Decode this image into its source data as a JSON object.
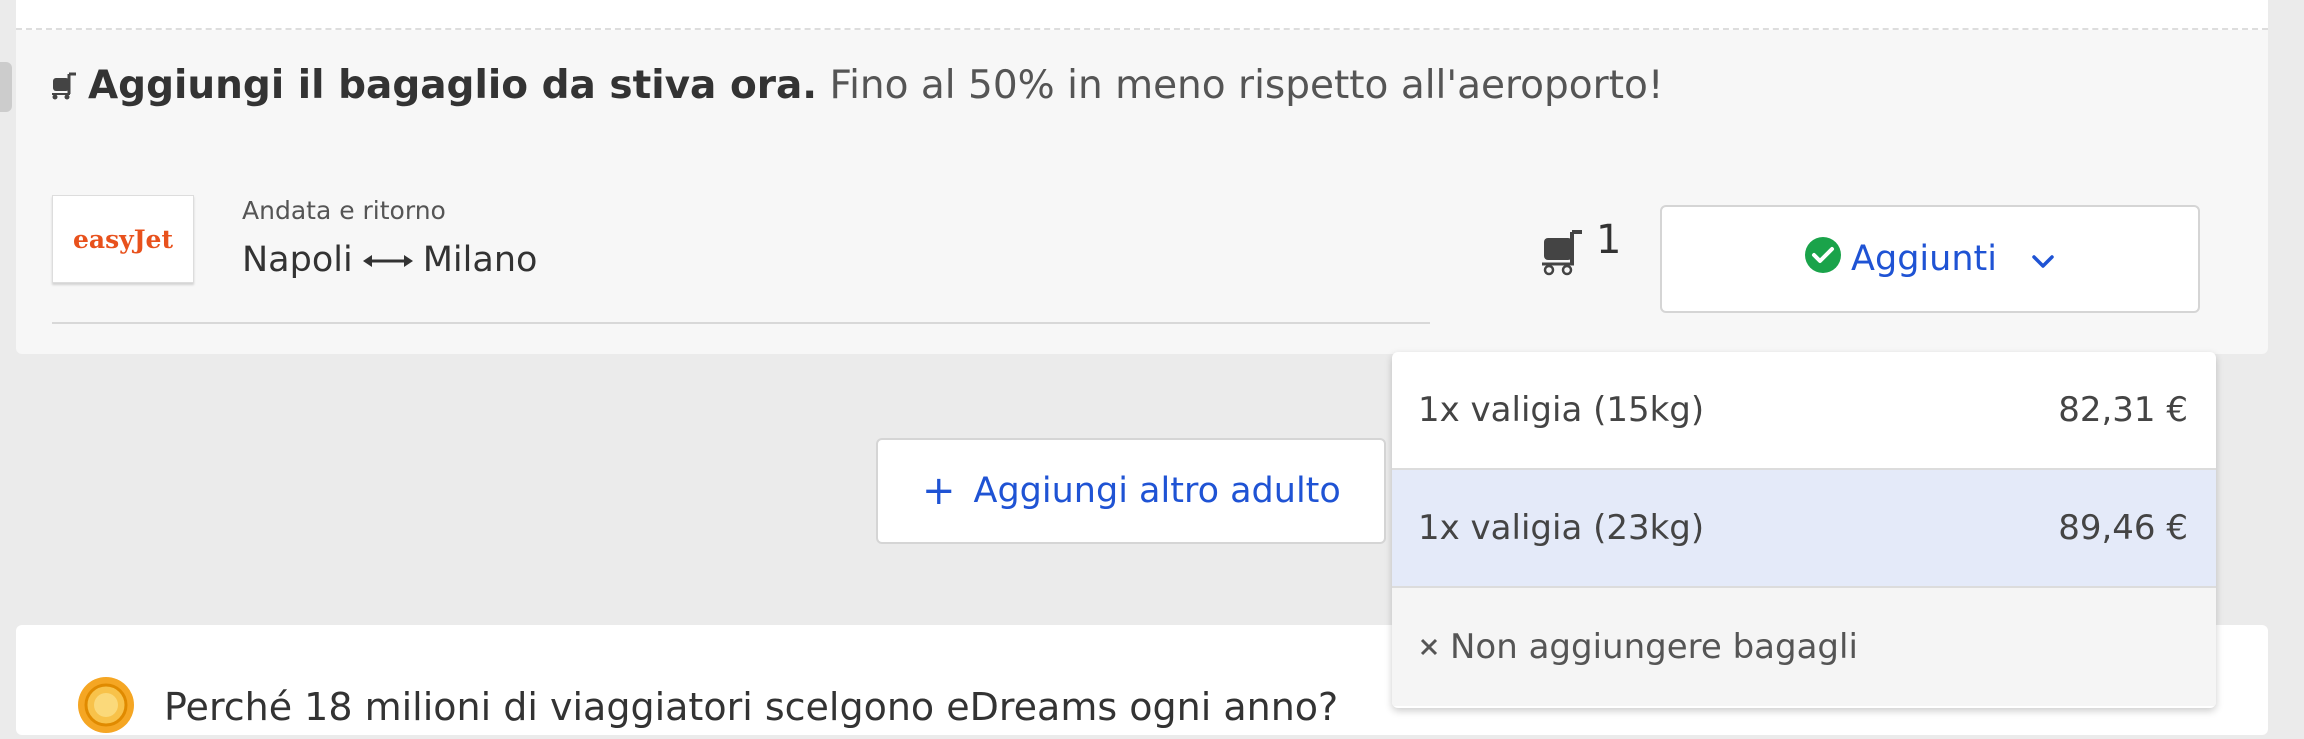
{
  "promo": {
    "bold": "Aggiungi il bagaglio da stiva ora.",
    "rest": " Fino al 50% in meno rispetto all'aeroporto!"
  },
  "flight": {
    "airline": "easyJet",
    "trip_type": "Andata e ritorno",
    "origin": "Napoli",
    "destination": "Milano",
    "bag_count": "1"
  },
  "status_button": {
    "label": "Aggiunti"
  },
  "add_adult_button": {
    "label": "Aggiungi altro adulto"
  },
  "dropdown": {
    "options": [
      {
        "label": "1x valigia (15kg)",
        "price": "82,31 €"
      },
      {
        "label": "1x valigia (23kg)",
        "price": "89,46 €"
      }
    ],
    "none_label": "Non aggiungere bagagli"
  },
  "bottom": {
    "text": "Perché 18 milioni di viaggiatori scelgono eDreams ogni anno?"
  },
  "colors": {
    "accent": "#1f53d4",
    "success": "#1aa34a",
    "airline": "#e8511c"
  }
}
